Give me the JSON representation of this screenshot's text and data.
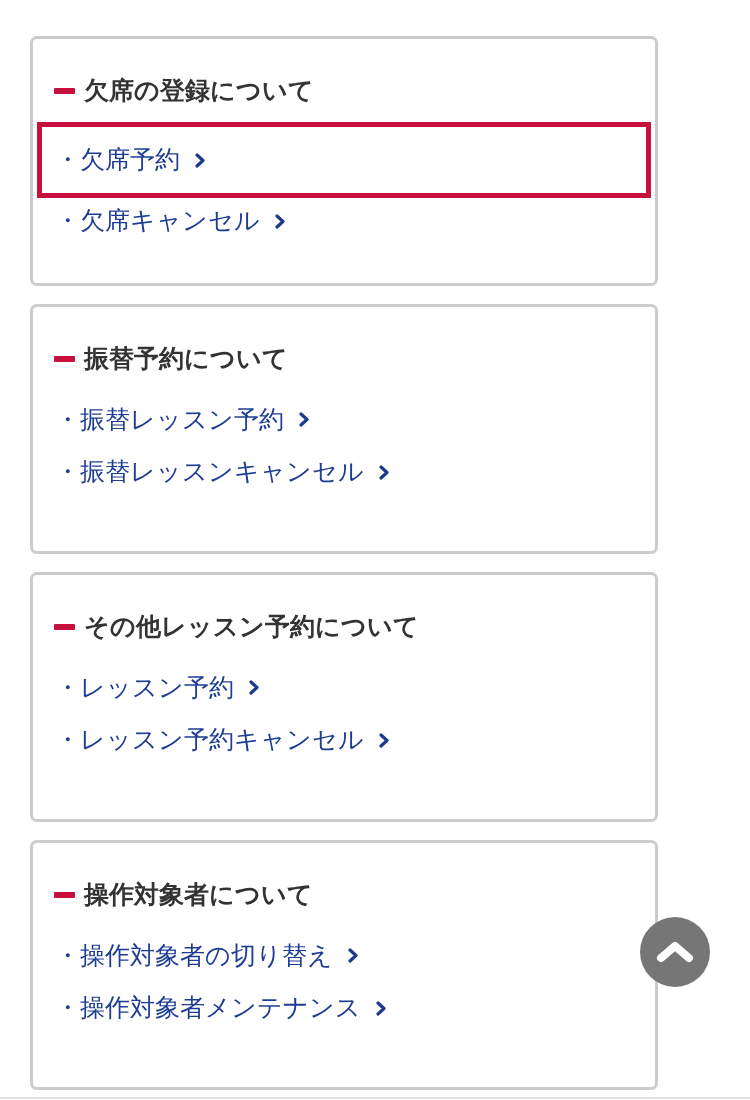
{
  "sections": [
    {
      "title": "欠席の登録について",
      "items": [
        {
          "label": "・欠席予約",
          "highlighted": true
        },
        {
          "label": "・欠席キャンセル",
          "highlighted": false
        }
      ]
    },
    {
      "title": "振替予約について",
      "items": [
        {
          "label": "・振替レッスン予約",
          "highlighted": false
        },
        {
          "label": "・振替レッスンキャンセル",
          "highlighted": false
        }
      ]
    },
    {
      "title": "その他レッスン予約について",
      "items": [
        {
          "label": "・レッスン予約",
          "highlighted": false
        },
        {
          "label": "・レッスン予約キャンセル",
          "highlighted": false
        }
      ]
    },
    {
      "title": "操作対象者について",
      "items": [
        {
          "label": "・操作対象者の切り替え",
          "highlighted": false
        },
        {
          "label": "・操作対象者メンテナンス",
          "highlighted": false
        }
      ]
    }
  ]
}
